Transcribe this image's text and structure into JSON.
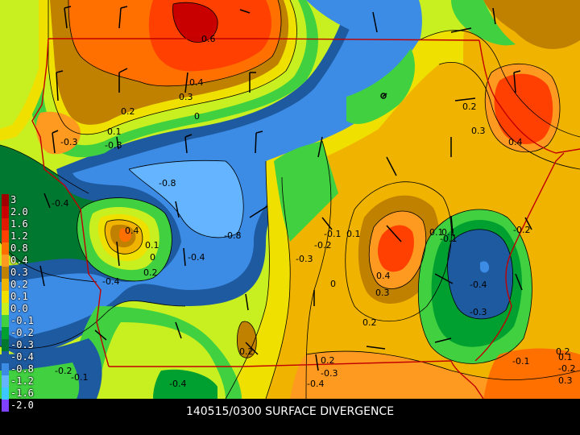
{
  "caption": "140515/0300 SURFACE DIVERGENCE",
  "legend": {
    "items": [
      {
        "label": "3",
        "color": "#a00000"
      },
      {
        "label": "2.0",
        "color": "#c80000"
      },
      {
        "label": "1.6",
        "color": "#e01a00"
      },
      {
        "label": "1.2",
        "color": "#ff4000"
      },
      {
        "label": "0.8",
        "color": "#ff7000"
      },
      {
        "label": "0.4",
        "color": "#ff9a20"
      },
      {
        "label": "0.3",
        "color": "#c08000"
      },
      {
        "label": "0.2",
        "color": "#f0b400"
      },
      {
        "label": "0.1",
        "color": "#f0e000"
      },
      {
        "label": "0.0",
        "color": "#c8f020"
      },
      {
        "label": "-0.1",
        "color": "#40d040"
      },
      {
        "label": "-0.2",
        "color": "#00a030"
      },
      {
        "label": "-0.3",
        "color": "#007830"
      },
      {
        "label": "-0.4",
        "color": "#1e5aa0"
      },
      {
        "label": "-0.8",
        "color": "#3c8ce6"
      },
      {
        "label": "-1.2",
        "color": "#64b4ff"
      },
      {
        "label": "-1.6",
        "color": "#3cc8ff"
      },
      {
        "label": "-2.0",
        "color": "#8040ff"
      }
    ]
  },
  "contour_labels": [
    "0.6",
    "0.4",
    "0.3",
    "0.2",
    "0",
    "-0.3",
    "0.1",
    "-0.8",
    "-0.8",
    "-0.8",
    "-0.4",
    "0.4",
    "0.1",
    "0",
    "0.2",
    "-0.4",
    "-0.4",
    "-0.3",
    "-0.2",
    "-0.1",
    "0.1",
    "0",
    "0.4",
    "0.3",
    "0.2",
    "0.1",
    "0.1",
    "-0.1",
    "-0.2",
    "-0.4",
    "-0.3",
    "-0.1",
    "0.2",
    "0.3",
    "0.4",
    "0.2",
    "0.2",
    "-0.3",
    "-0.4",
    "-0.4",
    "-0.2",
    "-0.1",
    "-0.2",
    "0.1",
    "0.2",
    "0.3"
  ]
}
